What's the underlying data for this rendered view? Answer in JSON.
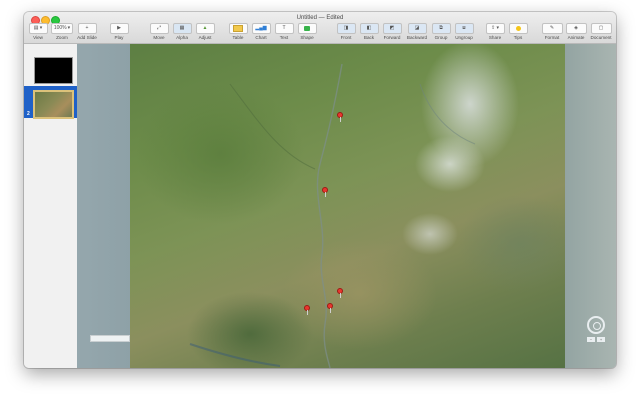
{
  "window": {
    "title": "Untitled — Edited"
  },
  "toolbar": {
    "view_label": "View",
    "zoom_label": "Zoom",
    "zoom_value": "100%",
    "add_slide_label": "Add Slide",
    "play_label": "Play",
    "move_label": "Move",
    "alpha_label": "Alpha",
    "adjust_label": "Adjust",
    "table_label": "Table",
    "chart_label": "Chart",
    "text_label": "Text",
    "shape_label": "Shape",
    "front_label": "Front",
    "back_label": "Back",
    "forward_label": "Forward",
    "backward_label": "Backward",
    "group_label": "Group",
    "ungroup_label": "Ungroup",
    "share_label": "Share",
    "tips_label": "Tips",
    "format_label": "Format",
    "animate_label": "Animate",
    "document_label": "Document"
  },
  "sidebar": {
    "slides": [
      {
        "number": "1"
      },
      {
        "number": "2"
      }
    ]
  },
  "map": {
    "pins": 5
  },
  "colors": {
    "selection": "#1f61c8",
    "pin": "#e8362d"
  }
}
